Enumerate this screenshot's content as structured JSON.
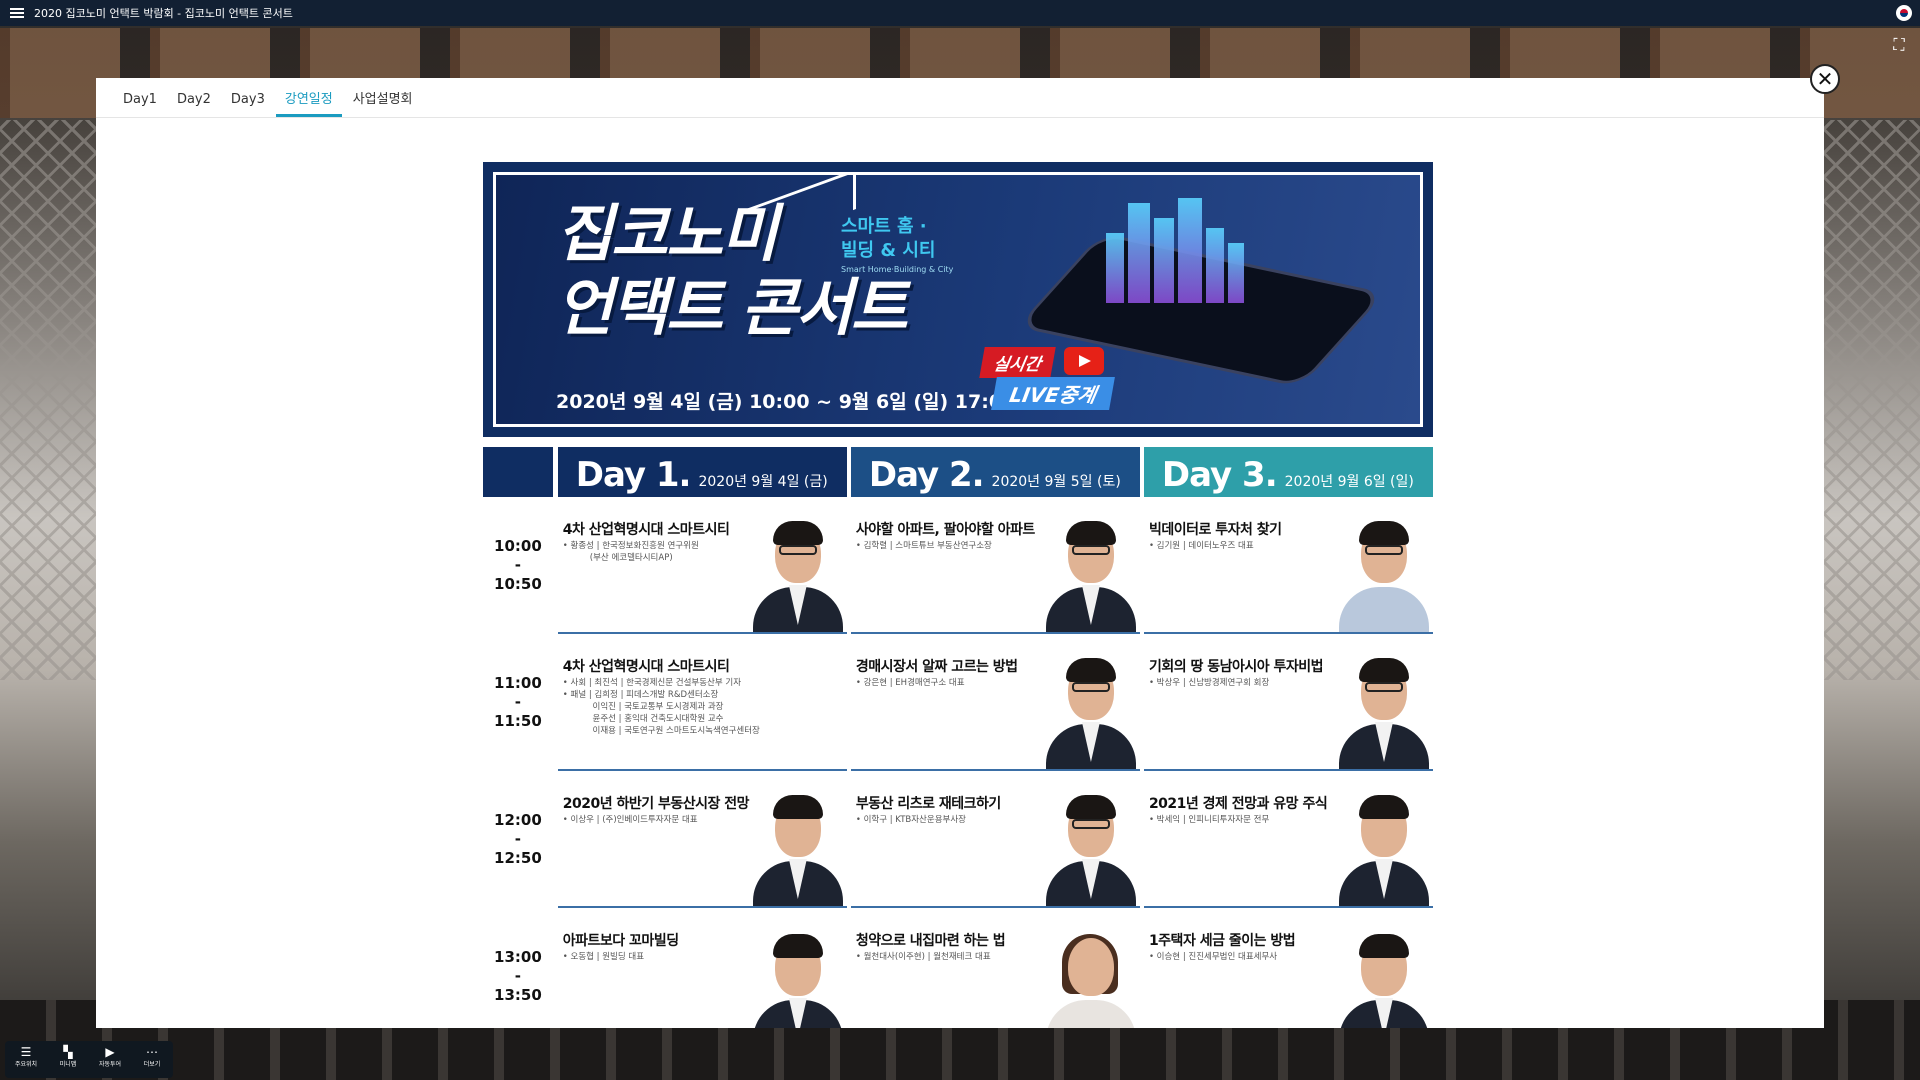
{
  "window_title": "2020 집코노미 언택트 박람회 - 집코노미 언택트 콘서트",
  "tabs": [
    {
      "label": "Day1"
    },
    {
      "label": "Day2"
    },
    {
      "label": "Day3"
    },
    {
      "label": "강연일정",
      "active": true
    },
    {
      "label": "사업설명회"
    }
  ],
  "close_label": "✕",
  "banner": {
    "title_line1": "집코노미",
    "title_line2": "언택트 콘서트",
    "subtitle_line1": "스마트 홈 ·",
    "subtitle_line2": "빌딩 & 시티",
    "subtitle_en": "Smart Home·Building & City",
    "date": "2020년 9월 4일 (금) 10:00 ~ 9월 6일 (일) 17:00",
    "live_badge1": "실시간",
    "live_badge2": "LIVE중계"
  },
  "days": [
    {
      "label": "Day 1.",
      "date": "2020년 9월 4일 (금)"
    },
    {
      "label": "Day 2.",
      "date": "2020년 9월 5일 (토)"
    },
    {
      "label": "Day 3.",
      "date": "2020년 9월 6일 (일)"
    }
  ],
  "rows": [
    {
      "time_start": "10:00",
      "time_sep": "-",
      "time_end": "10:50",
      "cells": [
        {
          "title": "4차 산업혁명시대 스마트시티",
          "speaker": "• 황종성 | 한국정보화진흥원 연구위원\n          (부산 에코델타시티AP)"
        },
        {
          "title": "사야할 아파트, 팔아야할 아파트",
          "speaker": "• 김학렬 | 스마트튜브 부동산연구소장"
        },
        {
          "title": "빅데이터로 투자처 찾기",
          "speaker": "• 김기원 | 데이터노우즈 대표"
        }
      ]
    },
    {
      "time_start": "11:00",
      "time_sep": "-",
      "time_end": "11:50",
      "cells": [
        {
          "title": "4차 산업혁명시대 스마트시티",
          "speaker": "• 사회 | 최진석 | 한국경제신문 건설부동산부 기자\n• 패널 | 김희정 | 피데스개발 R&D센터소장\n           이익진 | 국토교통부 도시경제과 과장\n           윤주선 | 홍익대 건축도시대학원 교수\n           이재용 | 국토연구원 스마트도시녹색연구센터장"
        },
        {
          "title": "경매시장서 알짜 고르는 방법",
          "speaker": "• 강은현 | EH경매연구소 대표"
        },
        {
          "title": "기회의 땅 동남아시아 투자비법",
          "speaker": "• 박상우 | 신남방경제연구회 회장"
        }
      ]
    },
    {
      "time_start": "12:00",
      "time_sep": "-",
      "time_end": "12:50",
      "cells": [
        {
          "title": "2020년 하반기 부동산시장 전망",
          "speaker": "• 이상우 | (주)인베이드투자자문 대표"
        },
        {
          "title": "부동산 리츠로 재테크하기",
          "speaker": "• 이학구 | KTB자산운용부사장"
        },
        {
          "title": "2021년 경제 전망과 유망 주식",
          "speaker": "• 박세익 | 인피니티투자자문 전무"
        }
      ]
    },
    {
      "time_start": "13:00",
      "time_sep": "-",
      "time_end": "13:50",
      "cells": [
        {
          "title": "아파트보다 꼬마빌딩",
          "speaker": "• 오동협 | 원빌딩 대표"
        },
        {
          "title": "청약으로 내집마련 하는 법",
          "speaker": "• 월천대사(이주현) | 월천재테크 대표"
        },
        {
          "title": "1주택자 세금 줄이는 방법",
          "speaker": "• 이승현 | 진진세무법인 대표세무사"
        }
      ]
    }
  ],
  "toolbar": [
    {
      "label": "주요위치",
      "icon": "list-icon"
    },
    {
      "label": "미니맵",
      "icon": "minimap-icon"
    },
    {
      "label": "자동투어",
      "icon": "play-icon"
    },
    {
      "label": "더보기",
      "icon": "more-icon"
    }
  ]
}
